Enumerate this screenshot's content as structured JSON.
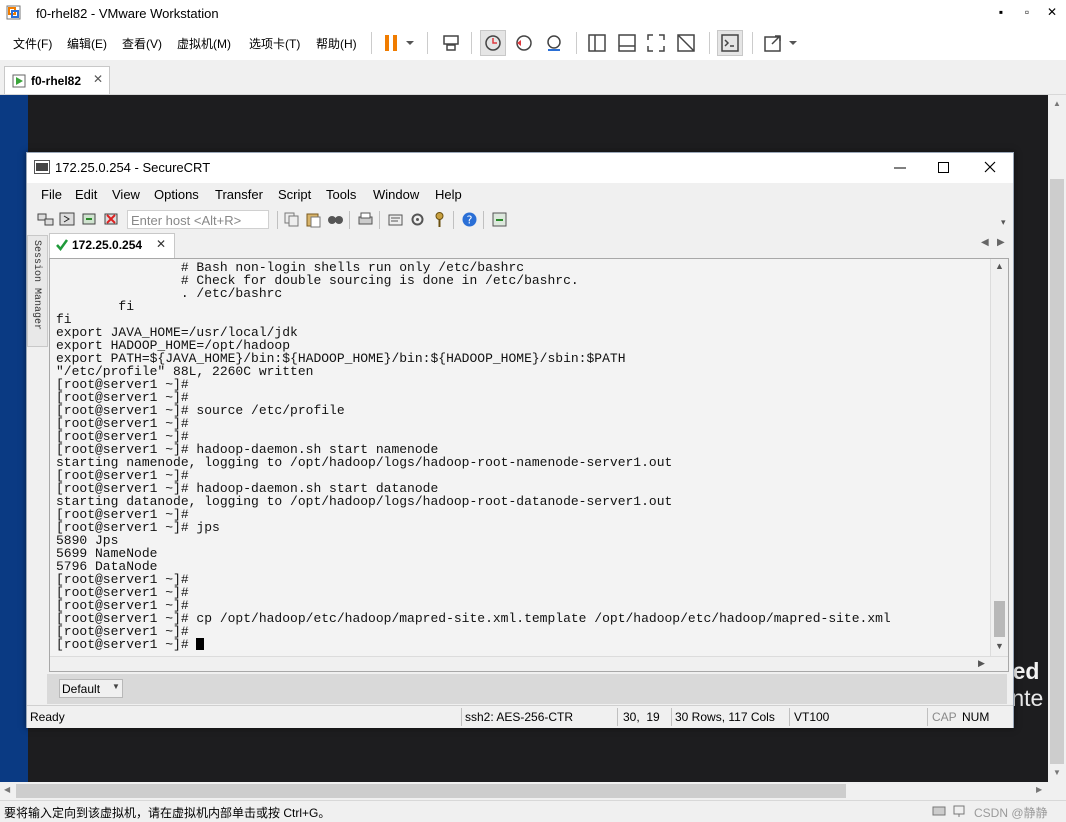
{
  "vmware": {
    "window_title": "f0-rhel82 - VMware Workstation",
    "menu": [
      "文件(F)",
      "编辑(E)",
      "查看(V)",
      "虚拟机(M)",
      "选项卡(T)",
      "帮助(H)"
    ],
    "tab_label": "f0-rhel82",
    "status_text": "要将输入定向到该虚拟机，请在虚拟机内部单击或按 Ctrl+G。",
    "watermark_text": "CSDN @静静"
  },
  "guest_overlay": {
    "line1": "Red",
    "line2": "Ente"
  },
  "securecrt": {
    "window_title": "172.25.0.254 - SecureCRT",
    "menu": [
      "File",
      "Edit",
      "View",
      "Options",
      "Transfer",
      "Script",
      "Tools",
      "Window",
      "Help"
    ],
    "host_placeholder": "Enter host <Alt+R>",
    "session_manager_label": "Session Manager",
    "tab_label": "172.25.0.254",
    "session_dropdown": "Default",
    "terminal_lines": [
      "                # Bash non-login shells run only /etc/bashrc",
      "                # Check for double sourcing is done in /etc/bashrc.",
      "                . /etc/bashrc",
      "        fi",
      "fi",
      "export JAVA_HOME=/usr/local/jdk",
      "export HADOOP_HOME=/opt/hadoop",
      "export PATH=${JAVA_HOME}/bin:${HADOOP_HOME}/bin:${HADOOP_HOME}/sbin:$PATH",
      "\"/etc/profile\" 88L, 2260C written",
      "[root@server1 ~]#",
      "[root@server1 ~]#",
      "[root@server1 ~]# source /etc/profile",
      "[root@server1 ~]#",
      "[root@server1 ~]#",
      "[root@server1 ~]# hadoop-daemon.sh start namenode",
      "starting namenode, logging to /opt/hadoop/logs/hadoop-root-namenode-server1.out",
      "[root@server1 ~]#",
      "[root@server1 ~]# hadoop-daemon.sh start datanode",
      "starting datanode, logging to /opt/hadoop/logs/hadoop-root-datanode-server1.out",
      "[root@server1 ~]#",
      "[root@server1 ~]# jps",
      "5890 Jps",
      "5699 NameNode",
      "5796 DataNode",
      "[root@server1 ~]#",
      "[root@server1 ~]#",
      "[root@server1 ~]#",
      "[root@server1 ~]# cp /opt/hadoop/etc/hadoop/mapred-site.xml.template /opt/hadoop/etc/hadoop/mapred-site.xml",
      "[root@server1 ~]#",
      "[root@server1 ~]# "
    ],
    "status": {
      "ready": "Ready",
      "cipher": "ssh2: AES-256-CTR",
      "cursor_pos": "30,  19",
      "size": "30 Rows, 117 Cols",
      "emulation": "VT100",
      "cap": "CAP",
      "num": "NUM"
    }
  },
  "colors": {
    "accent_orange": "#f07c00",
    "vm_blue": "#0a3a83",
    "redhat_red": "#e0393e"
  }
}
